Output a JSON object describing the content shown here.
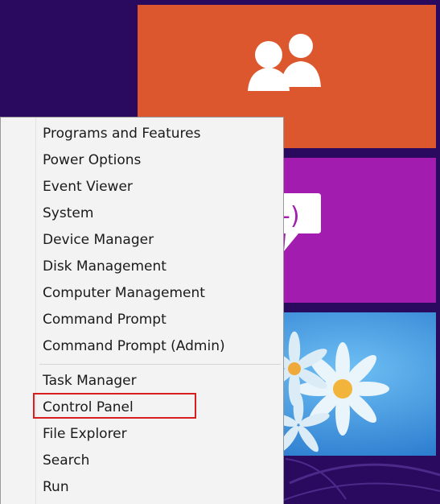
{
  "start_screen": {
    "tiles": [
      {
        "name": "people",
        "color": "#dc572e",
        "icon": "people-icon"
      },
      {
        "name": "messaging",
        "color": "#a21caf",
        "icon": "chat-icon"
      },
      {
        "name": "photos",
        "color": "#2d8be0",
        "icon": "flower-image"
      }
    ]
  },
  "context_menu": {
    "group1": [
      "Programs and Features",
      "Power Options",
      "Event Viewer",
      "System",
      "Device Manager",
      "Disk Management",
      "Computer Management",
      "Command Prompt",
      "Command Prompt (Admin)"
    ],
    "group2": [
      "Task Manager",
      "Control Panel",
      "File Explorer",
      "Search",
      "Run"
    ],
    "highlighted_item": "Control Panel",
    "highlight_color": "#d81e1e"
  }
}
